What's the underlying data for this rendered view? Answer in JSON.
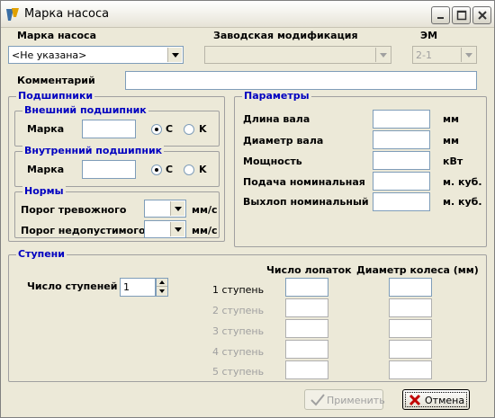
{
  "window": {
    "title": "Марка насоса"
  },
  "top": {
    "pump_brand_label": "Марка насоса",
    "pump_brand_value": "<Не указана>",
    "factory_mod_label": "Заводская модификация",
    "factory_mod_value": "",
    "em_label": "ЭМ",
    "em_value": "2-1",
    "comment_label": "Комментарий",
    "comment_value": ""
  },
  "bearings": {
    "title": "Подшипники",
    "outer": {
      "title": "Внешний подшипник",
      "brand_label": "Марка",
      "radio_c": "C",
      "radio_k": "K"
    },
    "inner": {
      "title": "Внутренний подшипник",
      "brand_label": "Марка",
      "radio_c": "C",
      "radio_k": "K"
    }
  },
  "norms": {
    "title": "Нормы",
    "alarm_label": "Порог тревожного",
    "alarm_unit": "мм/с",
    "critical_label": "Порог недопустимого",
    "critical_unit": "мм/с"
  },
  "params": {
    "title": "Параметры",
    "rows": [
      {
        "label": "Длина вала",
        "unit": "мм"
      },
      {
        "label": "Диаметр вала",
        "unit": "мм"
      },
      {
        "label": "Мощность",
        "unit": "кВт"
      },
      {
        "label": "Подача номинальная",
        "unit": "м. куб."
      },
      {
        "label": "Выхлоп номинальный",
        "unit": "м. куб."
      }
    ]
  },
  "stages": {
    "title": "Ступени",
    "count_label": "Число ступеней",
    "count_value": "1",
    "col_blades": "Число лопаток",
    "col_diameter": "Диаметр колеса (мм)",
    "rows": [
      {
        "label": "1 ступень"
      },
      {
        "label": "2 ступень"
      },
      {
        "label": "3 ступень"
      },
      {
        "label": "4 ступень"
      },
      {
        "label": "5 ступень"
      }
    ]
  },
  "buttons": {
    "apply": "Применить",
    "cancel": "Отмена"
  },
  "colors": {
    "group_title": "#0000c0",
    "dialog_bg": "#ece9d8",
    "cancel_icon": "#c00000"
  }
}
